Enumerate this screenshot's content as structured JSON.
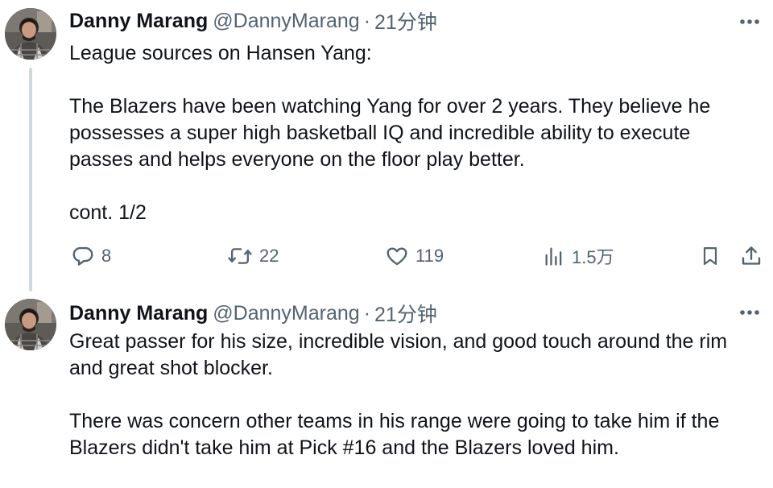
{
  "tweets": [
    {
      "author": {
        "name": "Danny Marang",
        "handle": "@DannyMarang"
      },
      "separator": "·",
      "time": "21分钟",
      "paragraphs": [
        "League sources on Hansen Yang:",
        "The Blazers have been watching Yang for over 2 years. They believe he possesses a super high basketball IQ and incredible ability to execute passes and helps everyone on the floor play better.",
        "cont. 1/2"
      ],
      "actions": {
        "replies": "8",
        "reposts": "22",
        "likes": "119",
        "views": "1.5万"
      }
    },
    {
      "author": {
        "name": "Danny Marang",
        "handle": "@DannyMarang"
      },
      "separator": "·",
      "time": "21分钟",
      "paragraphs": [
        "Great passer for his size, incredible vision, and good touch around the rim and great shot blocker.",
        "There was concern other teams in his range were going to take him if the Blazers didn't take him at Pick #16 and the Blazers loved him."
      ]
    }
  ],
  "icons": {
    "more": "more-horizontal-icon",
    "reply": "reply-icon",
    "repost": "repost-icon",
    "like": "heart-icon",
    "views": "views-icon",
    "bookmark": "bookmark-icon",
    "share": "share-icon"
  },
  "colors": {
    "text": "#0f1419",
    "secondary": "#536471",
    "thread_line": "#cfd9de"
  }
}
